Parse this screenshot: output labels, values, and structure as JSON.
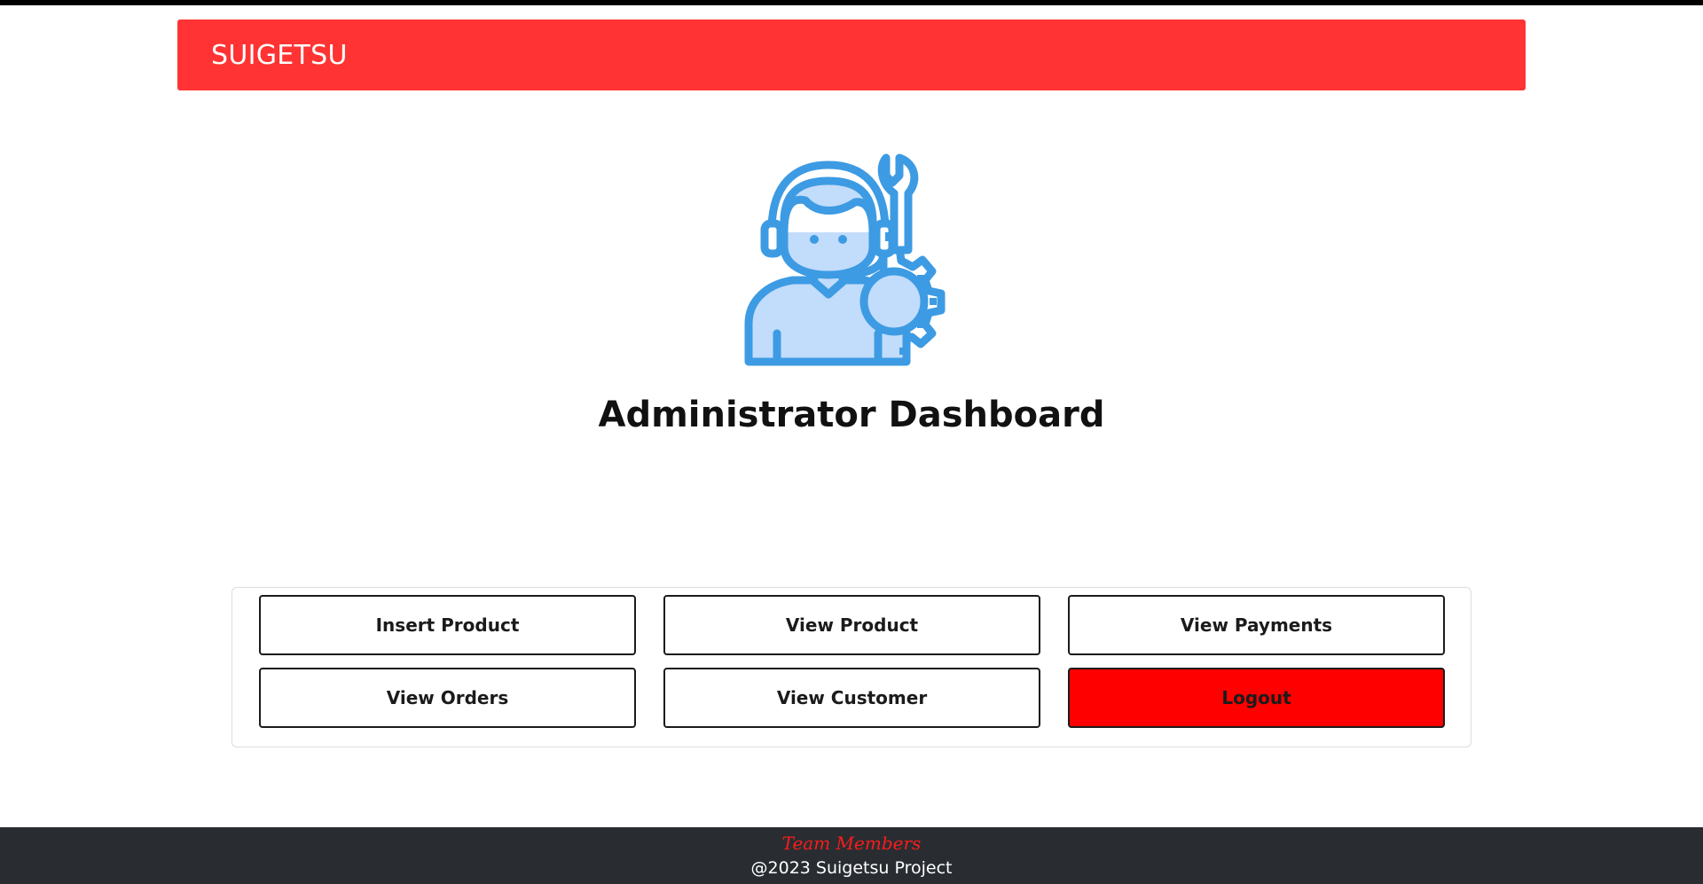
{
  "navbar": {
    "brand": "SUIGETSU",
    "color": "#ff3333"
  },
  "hero": {
    "icon": "support-agent-with-wrench-and-gear-icon",
    "title": "Administrator Dashboard"
  },
  "actions": {
    "insert_product": "Insert Product",
    "view_product": "View Product",
    "view_payments": "View Payments",
    "view_orders": "View Orders",
    "view_customer": "View Customer",
    "logout": "Logout",
    "logout_color": "#ff0000"
  },
  "footer": {
    "link": "Team Members",
    "copyright": "@2023 Suigetsu Project",
    "background": "#292d31"
  }
}
